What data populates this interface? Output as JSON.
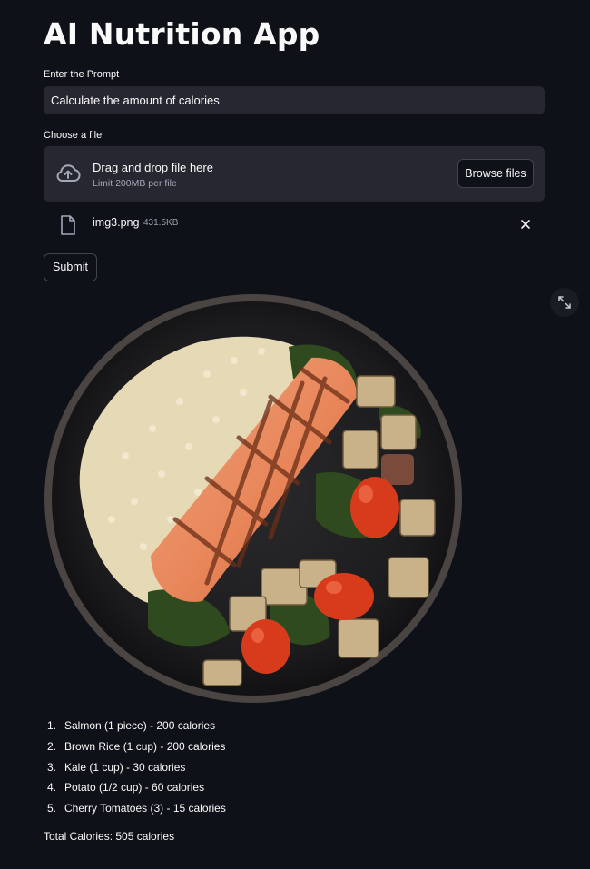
{
  "app": {
    "title": "AI Nutrition App"
  },
  "prompt": {
    "label": "Enter the Prompt",
    "value": "Calculate the amount of calories"
  },
  "uploader": {
    "label": "Choose a file",
    "drag_text": "Drag and drop file here",
    "limit_text": "Limit 200MB per file",
    "browse_label": "Browse files",
    "icon": "cloud-upload-icon"
  },
  "uploaded_file": {
    "name": "img3.png",
    "size": "431.5KB",
    "icon": "file-icon",
    "remove_icon": "close-icon"
  },
  "submit": {
    "label": "Submit"
  },
  "image": {
    "expand_icon": "fullscreen-icon"
  },
  "results": {
    "items": [
      {
        "num": "1.",
        "text": "Salmon (1 piece) - 200 calories"
      },
      {
        "num": "2.",
        "text": "Brown Rice (1 cup) - 200 calories"
      },
      {
        "num": "3.",
        "text": "Kale (1 cup) - 30 calories"
      },
      {
        "num": "4.",
        "text": "Potato (1/2 cup) - 60 calories"
      },
      {
        "num": "5.",
        "text": "Cherry Tomatoes (3) - 15 calories"
      }
    ],
    "total": "Total Calories: 505 calories"
  },
  "colors": {
    "background": "#0e1117",
    "input_bg": "#262730",
    "text": "#fafafa",
    "border": "#41444c"
  }
}
